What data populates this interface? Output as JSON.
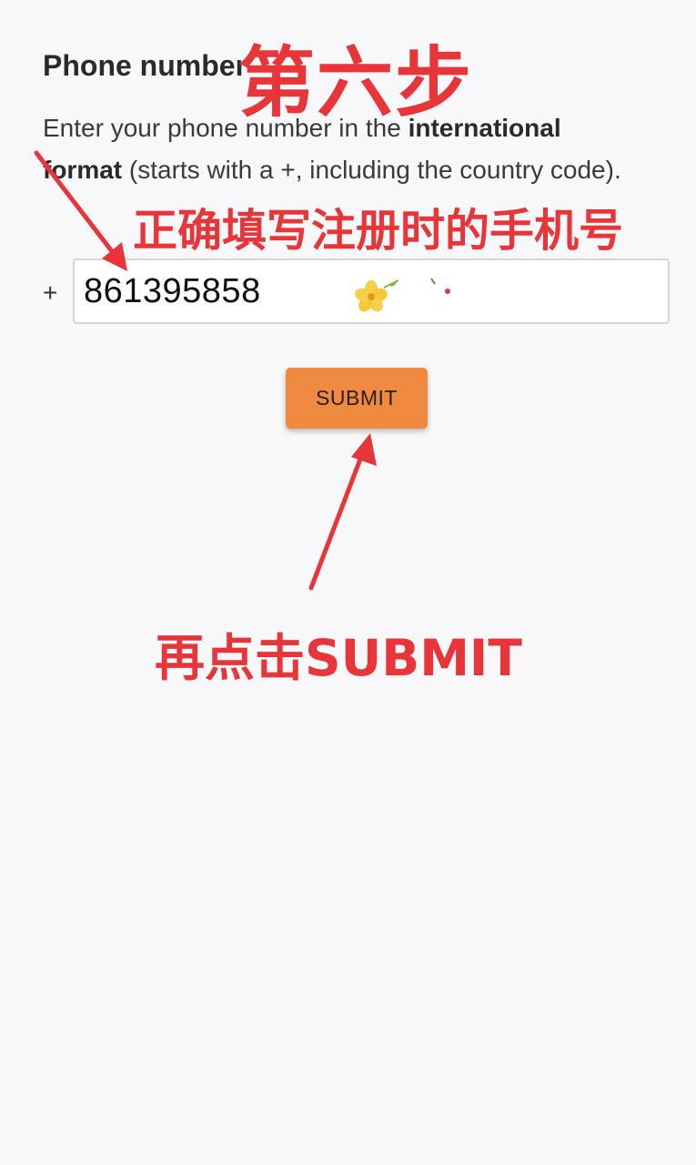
{
  "form": {
    "title": "Phone number",
    "instructions": {
      "part1": "Enter your phone number in the ",
      "bold": "international format",
      "part2": " (starts with a +, including the country code)."
    },
    "prefix": "+",
    "phone_value": "861395858",
    "submit_label": "SUBMIT"
  },
  "annotations": {
    "step_label": "第六步",
    "fill_hint": "正确填写注册时的手机号",
    "submit_hint": "再点击SUBMIT",
    "color": "#e8353a"
  },
  "colors": {
    "background": "#f8f8fa",
    "submit_button": "#f08a40"
  },
  "icons": {
    "sticker": "flower-sticker-icon"
  }
}
